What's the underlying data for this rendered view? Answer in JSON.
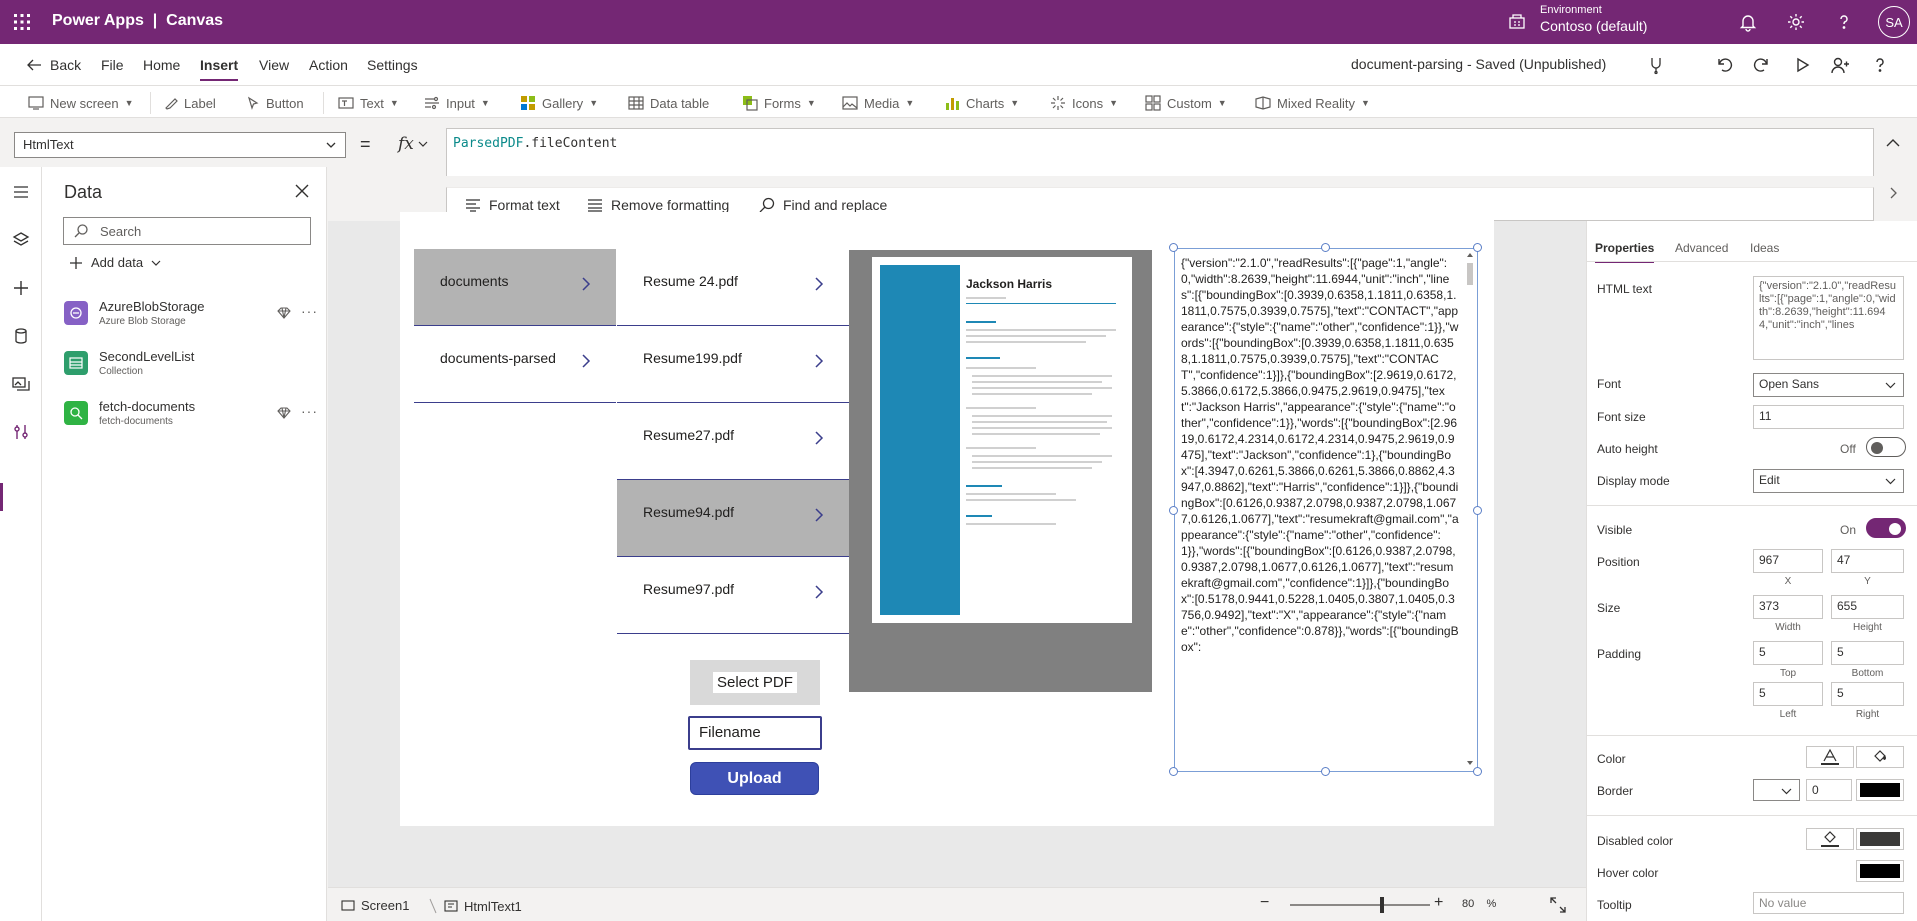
{
  "app": {
    "brand": "Power Apps",
    "separator": "|",
    "mode": "Canvas",
    "environment_label": "Environment",
    "environment_name": "Contoso (default)",
    "avatar_initials": "SA",
    "accent_color": "#742774"
  },
  "menu": {
    "back": "Back",
    "items": [
      "File",
      "Home",
      "Insert",
      "View",
      "Action",
      "Settings"
    ],
    "active": "Insert",
    "document_status": "document-parsing - Saved (Unpublished)"
  },
  "ribbon": {
    "items": [
      {
        "label": "New screen",
        "icon": "new-screen-icon",
        "dropdown": true
      },
      {
        "label": "Label",
        "icon": "label-icon",
        "dropdown": false
      },
      {
        "label": "Button",
        "icon": "button-icon",
        "dropdown": false
      },
      {
        "label": "Text",
        "icon": "text-icon",
        "dropdown": true
      },
      {
        "label": "Input",
        "icon": "input-icon",
        "dropdown": true
      },
      {
        "label": "Gallery",
        "icon": "gallery-icon",
        "dropdown": true
      },
      {
        "label": "Data table",
        "icon": "data-table-icon",
        "dropdown": false
      },
      {
        "label": "Forms",
        "icon": "forms-icon",
        "dropdown": true
      },
      {
        "label": "Media",
        "icon": "media-icon",
        "dropdown": true
      },
      {
        "label": "Charts",
        "icon": "charts-icon",
        "dropdown": true
      },
      {
        "label": "Icons",
        "icon": "icons-icon",
        "dropdown": true
      },
      {
        "label": "Custom",
        "icon": "custom-icon",
        "dropdown": true
      },
      {
        "label": "Mixed Reality",
        "icon": "mixed-reality-icon",
        "dropdown": true
      }
    ]
  },
  "formula": {
    "property": "HtmlText",
    "equals": "=",
    "fx": "fx",
    "object": "ParsedPDF",
    "member": ".fileContent",
    "tools": [
      "Format text",
      "Remove formatting",
      "Find and replace"
    ]
  },
  "data_panel": {
    "title": "Data",
    "search_placeholder": "Search",
    "add_data": "Add data",
    "sources": [
      {
        "name": "AzureBlobStorage",
        "sub": "Azure Blob Storage",
        "premium": true,
        "icon_color": "#8661c5"
      },
      {
        "name": "SecondLevelList",
        "sub": "Collection",
        "premium": false,
        "icon_color": "#2e9e6c"
      },
      {
        "name": "fetch-documents",
        "sub": "fetch-documents",
        "premium": true,
        "icon_color": "#2fb344"
      }
    ]
  },
  "canvas": {
    "folders": [
      {
        "label": "documents",
        "selected": true
      },
      {
        "label": "documents-parsed",
        "selected": false
      }
    ],
    "files": [
      {
        "label": "Resume 24.pdf",
        "selected": false
      },
      {
        "label": "Resume199.pdf",
        "selected": false
      },
      {
        "label": "Resume27.pdf",
        "selected": false
      },
      {
        "label": "Resume94.pdf",
        "selected": true
      },
      {
        "label": "Resume97.pdf",
        "selected": false
      }
    ],
    "resume_name": "Jackson Harris",
    "select_pdf": "Select PDF",
    "filename_placeholder": "Filename",
    "upload": "Upload",
    "html_text": "{\"version\":\"2.1.0\",\"readResults\":[{\"page\":1,\"angle\":0,\"width\":8.2639,\"height\":11.6944,\"unit\":\"inch\",\"lines\":[{\"boundingBox\":[0.3939,0.6358,1.1811,0.6358,1.1811,0.7575,0.3939,0.7575],\"text\":\"CONTACT\",\"appearance\":{\"style\":{\"name\":\"other\",\"confidence\":1}},\"words\":[{\"boundingBox\":[0.3939,0.6358,1.1811,0.6358,1.1811,0.7575,0.3939,0.7575],\"text\":\"CONTACT\",\"confidence\":1}]},{\"boundingBox\":[2.9619,0.6172,5.3866,0.6172,5.3866,0.9475,2.9619,0.9475],\"text\":\"Jackson Harris\",\"appearance\":{\"style\":{\"name\":\"other\",\"confidence\":1}},\"words\":[{\"boundingBox\":[2.9619,0.6172,4.2314,0.6172,4.2314,0.9475,2.9619,0.9475],\"text\":\"Jackson\",\"confidence\":1},{\"boundingBox\":[4.3947,0.6261,5.3866,0.6261,5.3866,0.8862,4.3947,0.8862],\"text\":\"Harris\",\"confidence\":1}]},{\"boundingBox\":[0.6126,0.9387,2.0798,0.9387,2.0798,1.0677,0.6126,1.0677],\"text\":\"resumekraft@gmail.com\",\"appearance\":{\"style\":{\"name\":\"other\",\"confidence\":1}},\"words\":[{\"boundingBox\":[0.6126,0.9387,2.0798,0.9387,2.0798,1.0677,0.6126,1.0677],\"text\":\"resumekraft@gmail.com\",\"confidence\":1}]},{\"boundingBox\":[0.5178,0.9441,0.5228,1.0405,0.3807,1.0405,0.3756,0.9492],\"text\":\"X\",\"appearance\":{\"style\":{\"name\":\"other\",\"confidence\":0.878}},\"words\":[{\"boundingBox\":"
  },
  "bottom": {
    "screen": "Screen1",
    "control": "HtmlText1",
    "zoom_minus": "−",
    "zoom_plus": "+",
    "zoom_value": "80",
    "zoom_unit": "%",
    "zoom_level": 0.66
  },
  "properties": {
    "tabs": [
      "Properties",
      "Advanced",
      "Ideas"
    ],
    "active_tab": "Properties",
    "html_text_label": "HTML text",
    "html_text_value": "{\"version\":\"2.1.0\",\"readResults\":[{\"page\":1,\"angle\":0,\"width\":8.2639,\"height\":11.6944,\"unit\":\"inch\",\"lines",
    "font_label": "Font",
    "font_value": "Open Sans",
    "font_size_label": "Font size",
    "font_size_value": "11",
    "auto_height_label": "Auto height",
    "auto_height_state": "Off",
    "display_mode_label": "Display mode",
    "display_mode_value": "Edit",
    "visible_label": "Visible",
    "visible_state": "On",
    "position_label": "Position",
    "position_x": "967",
    "position_y": "47",
    "x_label": "X",
    "y_label": "Y",
    "size_label": "Size",
    "width_value": "373",
    "height_value": "655",
    "width_label": "Width",
    "height_label": "Height",
    "padding_label": "Padding",
    "padding_top": "5",
    "padding_bottom": "5",
    "padding_left": "5",
    "padding_right": "5",
    "top_label": "Top",
    "bottom_label": "Bottom",
    "left_label": "Left",
    "right_label": "Right",
    "color_label": "Color",
    "border_label": "Border",
    "border_width": "0",
    "disabled_color_label": "Disabled color",
    "hover_color_label": "Hover color",
    "tooltip_label": "Tooltip",
    "tooltip_placeholder": "No value"
  }
}
